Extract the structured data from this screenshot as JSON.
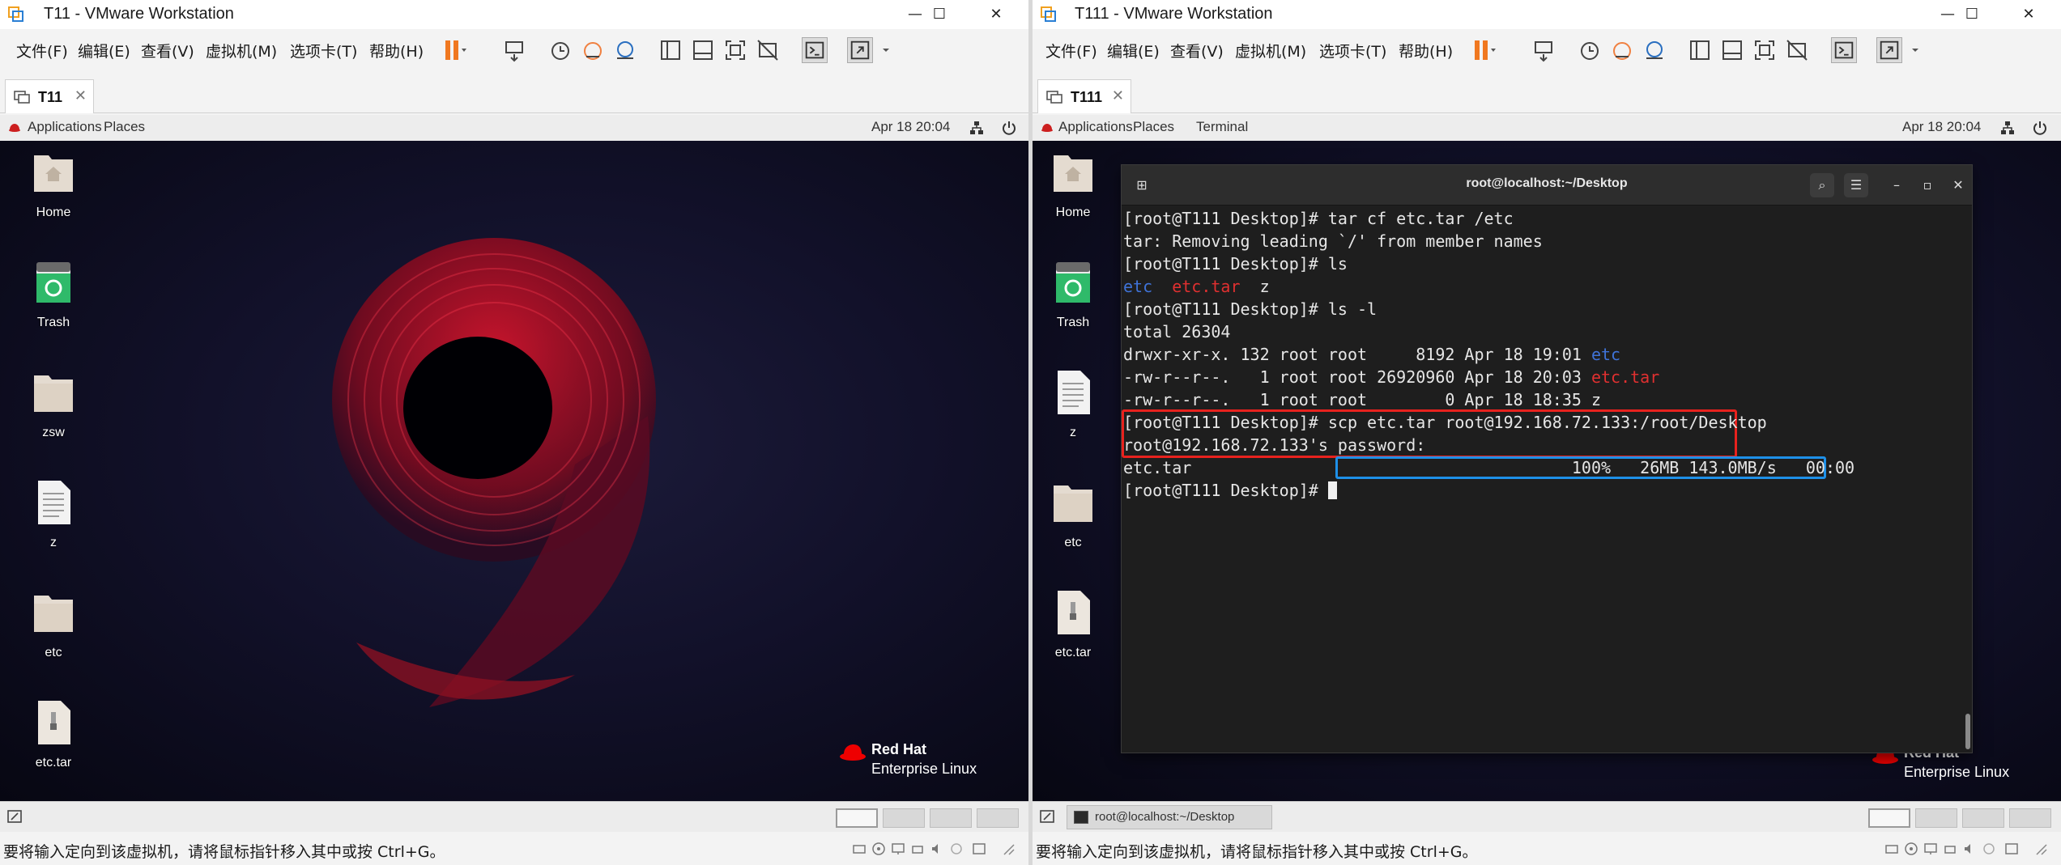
{
  "colors": {
    "desktop_bg": "#12112a",
    "logo_red": "#c8102e",
    "dir_blue": "#3f73d8",
    "archive_red": "#e03030",
    "highlight_red": "#e8221e",
    "highlight_blue": "#1e90e8"
  },
  "left": {
    "window": {
      "title": "T11 - VMware Workstation",
      "minimize": "—",
      "maximize": "☐",
      "close": "✕"
    },
    "menu": [
      "文件(F)",
      "编辑(E)",
      "查看(V)",
      "虚拟机(M)",
      "选项卡(T)",
      "帮助(H)"
    ],
    "tab": {
      "label": "T11",
      "close": "✕"
    },
    "topbar": {
      "applications": "Applications",
      "places": "Places",
      "clock": "Apr 18  20:04"
    },
    "desktop_icons": [
      {
        "label": "Home",
        "kind": "home"
      },
      {
        "label": "Trash",
        "kind": "trash"
      },
      {
        "label": "zsw",
        "kind": "folder"
      },
      {
        "label": "z",
        "kind": "file"
      },
      {
        "label": "etc",
        "kind": "folder"
      },
      {
        "label": "etc.tar",
        "kind": "archive"
      }
    ],
    "brand": {
      "line1": "Red Hat",
      "line2": "Enterprise Linux"
    },
    "status": "要将输入定向到该虚拟机，请将鼠标指针移入其中或按 Ctrl+G。"
  },
  "right": {
    "window": {
      "title": "T111 - VMware Workstation",
      "minimize": "—",
      "maximize": "☐",
      "close": "✕"
    },
    "menu": [
      "文件(F)",
      "编辑(E)",
      "查看(V)",
      "虚拟机(M)",
      "选项卡(T)",
      "帮助(H)"
    ],
    "tab": {
      "label": "T111",
      "close": "✕"
    },
    "topbar": {
      "applications": "Applications",
      "places": "Places",
      "terminal": "Terminal",
      "clock": "Apr 18  20:04"
    },
    "desktop_icons": [
      {
        "label": "Home",
        "kind": "home"
      },
      {
        "label": "Trash",
        "kind": "trash"
      },
      {
        "label": "z",
        "kind": "file"
      },
      {
        "label": "etc",
        "kind": "folder"
      },
      {
        "label": "etc.tar",
        "kind": "archive"
      }
    ],
    "brand": {
      "line1": "Red Hat",
      "line2": "Enterprise Linux"
    },
    "taskbar": {
      "window_label": "root@localhost:~/Desktop"
    },
    "status": "要将输入定向到该虚拟机，请将鼠标指针移入其中或按 Ctrl+G。",
    "terminal": {
      "title": "root@localhost:~/Desktop",
      "lines": [
        {
          "segments": [
            {
              "text": "[root@T111 Desktop]# tar cf etc.tar /etc"
            }
          ]
        },
        {
          "segments": [
            {
              "text": "tar: Removing leading `/' from member names"
            }
          ]
        },
        {
          "segments": [
            {
              "text": "[root@T111 Desktop]# ls"
            }
          ]
        },
        {
          "segments": [
            {
              "text": "etc",
              "cls": "dir"
            },
            {
              "text": "  "
            },
            {
              "text": "etc.tar",
              "cls": "arc"
            },
            {
              "text": "  z"
            }
          ]
        },
        {
          "segments": [
            {
              "text": "[root@T111 Desktop]# ls -l"
            }
          ]
        },
        {
          "segments": [
            {
              "text": "total 26304"
            }
          ]
        },
        {
          "segments": [
            {
              "text": "drwxr-xr-x. 132 root root     8192 Apr 18 19:01 "
            },
            {
              "text": "etc",
              "cls": "dir"
            }
          ]
        },
        {
          "segments": [
            {
              "text": "-rw-r--r--.   1 root root 26920960 Apr 18 20:03 "
            },
            {
              "text": "etc.tar",
              "cls": "arc"
            }
          ]
        },
        {
          "segments": [
            {
              "text": "-rw-r--r--.   1 root root        0 Apr 18 18:35 z"
            }
          ]
        },
        {
          "segments": [
            {
              "text": "[root@T111 Desktop]# scp etc.tar root@192.168.72.133:/root/Desktop"
            }
          ]
        },
        {
          "segments": [
            {
              "text": "root@192.168.72.133's password:"
            }
          ]
        },
        {
          "segments": [
            {
              "text": "etc.tar                                       100%   26MB 143.0MB/s   00:00"
            }
          ]
        },
        {
          "segments": [
            {
              "text": "[root@T111 Desktop]# "
            }
          ],
          "cursor": true
        }
      ]
    }
  }
}
